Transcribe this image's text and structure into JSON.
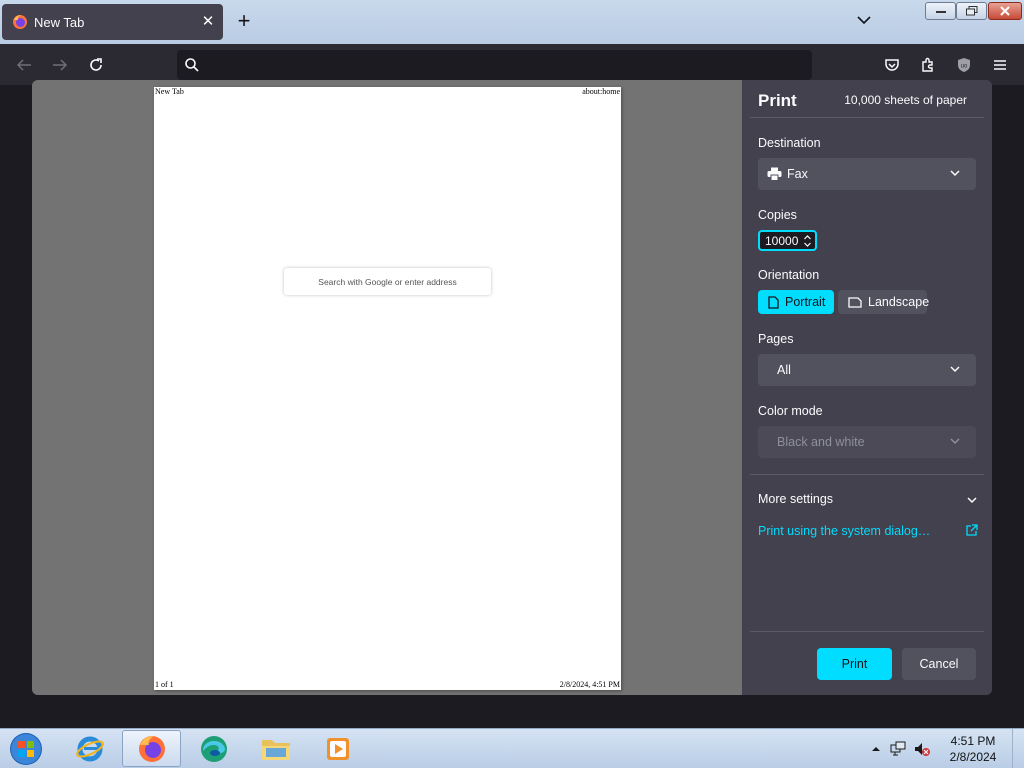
{
  "browser": {
    "tab": {
      "title": "New Tab"
    },
    "urlbar": {
      "value": "",
      "placeholder": ""
    }
  },
  "preview": {
    "header_left": "New Tab",
    "header_right": "about:home",
    "footer_left": "1 of 1",
    "footer_right": "2/8/2024, 4:51 PM",
    "search_placeholder": "Search with Google or enter address"
  },
  "print": {
    "title": "Print",
    "sheets": "10,000 sheets of paper",
    "destination_label": "Destination",
    "destination_value": "Fax",
    "copies_label": "Copies",
    "copies_value": "10000",
    "orientation_label": "Orientation",
    "portrait_label": "Portrait",
    "landscape_label": "Landscape",
    "orientation_selected": "Portrait",
    "pages_label": "Pages",
    "pages_value": "All",
    "color_mode_label": "Color mode",
    "color_mode_value": "Black and white",
    "more_settings": "More settings",
    "system_dialog_link": "Print using the system dialog…",
    "print_button": "Print",
    "cancel_button": "Cancel"
  },
  "taskbar": {
    "time": "4:51 PM",
    "date": "2/8/2024",
    "apps": [
      "internet-explorer",
      "firefox",
      "edge",
      "file-explorer",
      "media-player"
    ]
  },
  "colors": {
    "accent": "#00ddff",
    "panel": "#42414d",
    "field": "#52515e",
    "toolbar": "#2b2a33"
  }
}
